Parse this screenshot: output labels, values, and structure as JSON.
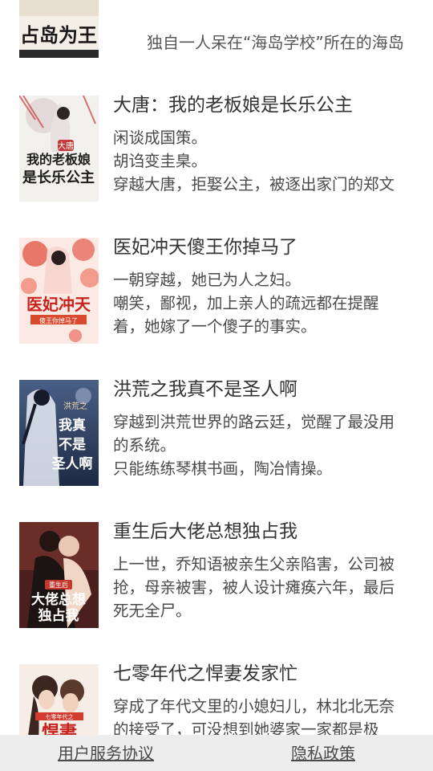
{
  "top_item": {
    "cover_text": "占岛为王",
    "description": "独自一人呆在“海岛学校”所在的海岛"
  },
  "books": [
    {
      "title": "大唐：我的老板娘是长乐公主",
      "cover_text": "我的老板娘是长乐公主",
      "cover_sub": "大唐",
      "description_lines": [
        "闲谈成国策。",
        "胡诌变圭臬。",
        "穿越大唐，拒娶公主，被逐出家门的郑文"
      ]
    },
    {
      "title": "医妃冲天傻王你掉马了",
      "cover_text": "医妃冲天",
      "cover_sub": "傻王你掉马了",
      "description_lines": [
        "一朝穿越，她已为人之妇。",
        "嘲笑，鄙视，加上亲人的疏远都在提醒",
        "着，她嫁了一个傻子的事实。"
      ]
    },
    {
      "title": "洪荒之我真不是圣人啊",
      "cover_text": "我真不是圣人啊",
      "cover_sub": "洪荒之",
      "description_lines": [
        "穿越到洪荒世界的路云廷，觉醒了最没用",
        "的系统。",
        "只能练练琴棋书画，陶冶情操。"
      ]
    },
    {
      "title": "重生后大佬总想独占我",
      "cover_text": "大佬总想独占我",
      "cover_sub": "重生后",
      "description_lines": [
        "上一世，乔知语被亲生父亲陷害，公司被",
        "抢，母亲被害，被人设计瘫痪六年，最后",
        "死无全尸。"
      ]
    },
    {
      "title": "七零年代之悍妻发家忙",
      "cover_text": "悍妻",
      "cover_sub": "七零年代之",
      "description_lines": [
        "穿成了年代文里的小媳妇儿，林北北无奈",
        "的接受了，可没想到她婆家一家都是极"
      ]
    }
  ],
  "footer": {
    "terms_label": "用户服务协议",
    "privacy_label": "隐私政策"
  },
  "colors": {
    "footer_bg": "#ededed",
    "title_text": "#333333",
    "body_text": "#4a4a4a"
  }
}
